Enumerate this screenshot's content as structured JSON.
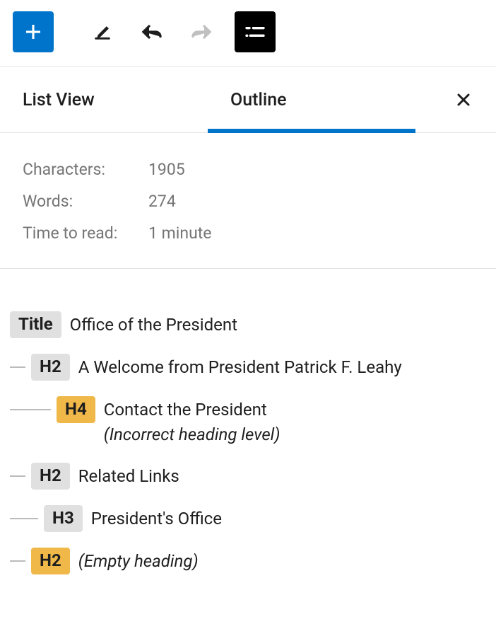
{
  "toolbar": {
    "add_label": "Add block",
    "edit_label": "Edit",
    "undo_label": "Undo",
    "redo_label": "Redo",
    "docoverview_label": "Document overview"
  },
  "tabs": {
    "list_view": "List View",
    "outline": "Outline",
    "close_label": "Close"
  },
  "stats": {
    "characters_label": "Characters:",
    "characters_value": "1905",
    "words_label": "Words:",
    "words_value": "274",
    "time_label": "Time to read:",
    "time_value": "1 minute"
  },
  "outline": [
    {
      "badge": "Title",
      "badge_style": "title-b",
      "indent": 0,
      "text": "Office of the President",
      "note": ""
    },
    {
      "badge": "H2",
      "badge_style": "grey",
      "indent": 1,
      "text": "A Welcome from President Patrick F. Leahy",
      "note": ""
    },
    {
      "badge": "H4",
      "badge_style": "warn",
      "indent": 2,
      "text": "Contact the President",
      "note": "(Incorrect heading level)"
    },
    {
      "badge": "H2",
      "badge_style": "grey",
      "indent": 1,
      "text": "Related Links",
      "note": ""
    },
    {
      "badge": "H3",
      "badge_style": "grey",
      "indent": 3,
      "text": "President's Office",
      "note": ""
    },
    {
      "badge": "H2",
      "badge_style": "warn",
      "indent": 1,
      "text": "",
      "note": "(Empty heading)"
    }
  ]
}
